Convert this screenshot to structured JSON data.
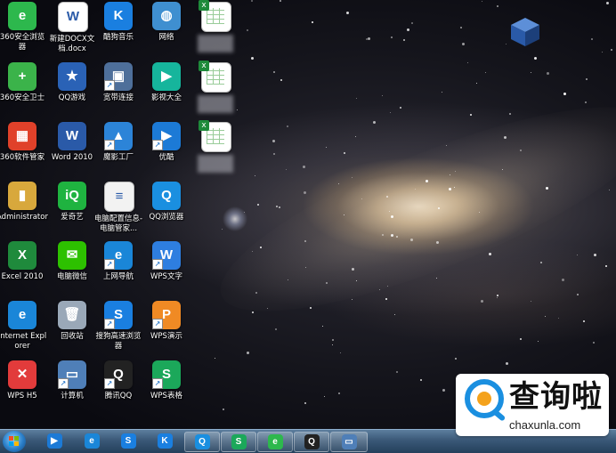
{
  "desktop": {
    "icons": [
      {
        "label": "360安全浏览器",
        "icon": "360-browser-icon",
        "color": "#2db84d",
        "glyph": "e"
      },
      {
        "label": "新建DOCX文档.docx",
        "icon": "word-document-icon",
        "color": "#ffffff",
        "glyph": "W"
      },
      {
        "label": "酷狗音乐",
        "icon": "kugou-music-icon",
        "color": "#1a7fe0",
        "glyph": "K"
      },
      {
        "label": "网络",
        "icon": "network-globe-icon",
        "color": "#3f8fd0",
        "glyph": "◍"
      },
      {
        "label": "360安全卫士",
        "icon": "360-security-guard-icon",
        "color": "#3bb34a",
        "glyph": "+"
      },
      {
        "label": "QQ游戏",
        "icon": "qq-game-icon",
        "color": "#2a62b6",
        "glyph": "★"
      },
      {
        "label": "宽带连接",
        "icon": "broadband-connection-icon",
        "color": "#4e6f9a",
        "glyph": "▣"
      },
      {
        "label": "影视大全",
        "icon": "video-app-icon",
        "color": "#16b59c",
        "glyph": "▶"
      },
      {
        "label": "360软件管家",
        "icon": "360-software-manager-icon",
        "color": "#e0412a",
        "glyph": "▦"
      },
      {
        "label": "Word 2010",
        "icon": "word-2010-icon",
        "color": "#2a5aa8",
        "glyph": "W"
      },
      {
        "label": "魔影工厂",
        "icon": "video-factory-icon",
        "color": "#2c84d8",
        "glyph": "▲"
      },
      {
        "label": "优酷",
        "icon": "youku-icon",
        "color": "#1c7ad6",
        "glyph": "▶"
      },
      {
        "label": "Administrator",
        "icon": "user-folder-icon",
        "color": "#d8a83c",
        "glyph": "▮"
      },
      {
        "label": "爱奇艺",
        "icon": "iqiyi-icon",
        "color": "#1fb340",
        "glyph": "iQ"
      },
      {
        "label": "电脑配置信息-电脑管家...",
        "icon": "text-document-icon",
        "color": "#f2f2f2",
        "glyph": "≡"
      },
      {
        "label": "QQ浏览器",
        "icon": "qq-browser-icon",
        "color": "#1a8fe0",
        "glyph": "Q"
      },
      {
        "label": "Excel 2010",
        "icon": "excel-2010-icon",
        "color": "#1f8a3c",
        "glyph": "X"
      },
      {
        "label": "电脑微信",
        "icon": "wechat-icon",
        "color": "#2dc100",
        "glyph": "✉"
      },
      {
        "label": "上网导航",
        "icon": "ie-navigation-icon",
        "color": "#1a86d8",
        "glyph": "e"
      },
      {
        "label": "WPS文字",
        "icon": "wps-writer-icon",
        "color": "#2e7ee0",
        "glyph": "W"
      },
      {
        "label": "Internet Explorer",
        "icon": "internet-explorer-icon",
        "color": "#1a86d8",
        "glyph": "e"
      },
      {
        "label": "回收站",
        "icon": "recycle-bin-icon",
        "color": "#9aa8b8",
        "glyph": "🗑"
      },
      {
        "label": "搜狗高速浏览器",
        "icon": "sogou-browser-icon",
        "color": "#1a7fe0",
        "glyph": "S"
      },
      {
        "label": "WPS演示",
        "icon": "wps-presentation-icon",
        "color": "#f08a24",
        "glyph": "P"
      },
      {
        "label": "WPS H5",
        "icon": "wps-h5-icon",
        "color": "#e23b3b",
        "glyph": "✕"
      },
      {
        "label": "计算机",
        "icon": "computer-icon",
        "color": "#4f7fb8",
        "glyph": "▭"
      },
      {
        "label": "腾讯QQ",
        "icon": "tencent-qq-icon",
        "color": "#222222",
        "glyph": "Q"
      },
      {
        "label": "WPS表格",
        "icon": "wps-spreadsheet-icon",
        "color": "#1ba85a",
        "glyph": "S"
      },
      {
        "label": "",
        "icon": "excel-file-icon",
        "color": "#ffffff",
        "glyph": ""
      },
      {
        "label": "",
        "icon": "excel-file-icon",
        "color": "#ffffff",
        "glyph": ""
      },
      {
        "label": "",
        "icon": "excel-file-icon",
        "color": "#ffffff",
        "glyph": ""
      }
    ]
  },
  "taskbar": {
    "start_icon": "windows-start-icon",
    "items": [
      {
        "icon": "youku-icon",
        "color": "#1c7ad6",
        "glyph": "▶",
        "open": false
      },
      {
        "icon": "internet-explorer-icon",
        "color": "#1a86d8",
        "glyph": "e",
        "open": false
      },
      {
        "icon": "sogou-browser-icon",
        "color": "#1a7fe0",
        "glyph": "S",
        "open": false
      },
      {
        "icon": "kugou-music-icon",
        "color": "#1a7fe0",
        "glyph": "K",
        "open": false
      },
      {
        "icon": "qq-browser-icon",
        "color": "#1a8fe0",
        "glyph": "Q",
        "open": true
      },
      {
        "icon": "wps-spreadsheet-icon",
        "color": "#1ba85a",
        "glyph": "S",
        "open": true
      },
      {
        "icon": "360-browser-icon",
        "color": "#2db84d",
        "glyph": "e",
        "open": true
      },
      {
        "icon": "tencent-qq-icon",
        "color": "#222222",
        "glyph": "Q",
        "open": true
      },
      {
        "icon": "remote-desktop-icon",
        "color": "#4f7fb8",
        "glyph": "▭",
        "open": true
      }
    ]
  },
  "watermark": {
    "title": "查询啦",
    "url": "chaxunla.com",
    "accent": "#1a8fe0"
  }
}
